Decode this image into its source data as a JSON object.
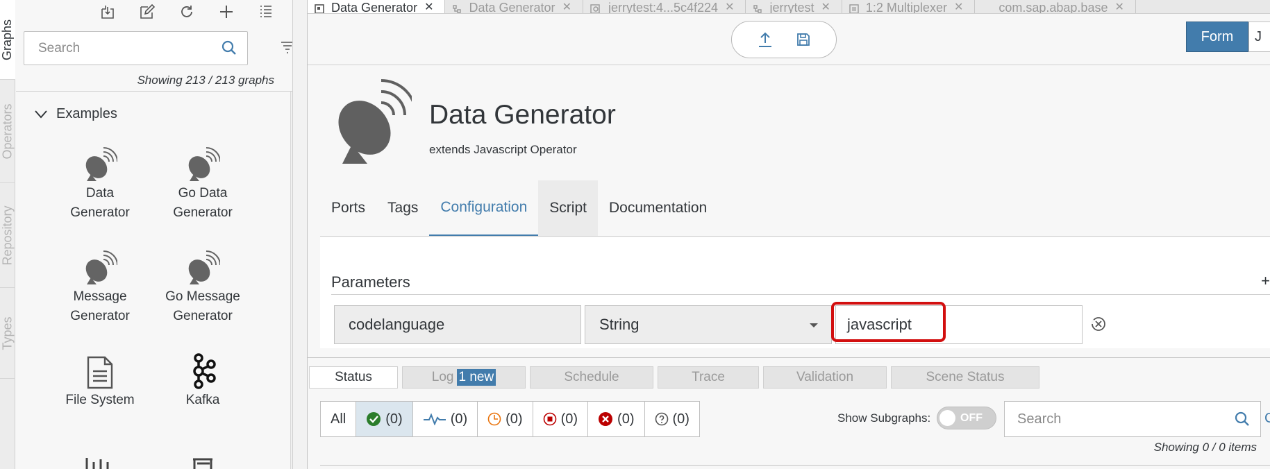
{
  "vertical_tabs": {
    "graphs": "Graphs",
    "operators": "Operators",
    "repository": "Repository",
    "types": "Types"
  },
  "left": {
    "search_placeholder": "Search",
    "showing": "Showing 213 / 213 graphs",
    "section": "Examples",
    "items": [
      {
        "label1": "Data",
        "label2": "Generator",
        "icon": "satellite-dish-icon"
      },
      {
        "label1": "Go Data",
        "label2": "Generator",
        "icon": "satellite-dish-icon"
      },
      {
        "label1": "Message",
        "label2": "Generator",
        "icon": "satellite-dish-icon"
      },
      {
        "label1": "Go Message",
        "label2": "Generator",
        "icon": "satellite-dish-icon"
      },
      {
        "label1": "File System",
        "label2": "",
        "icon": "document-icon"
      },
      {
        "label1": "Kafka",
        "label2": "",
        "icon": "kafka-icon"
      }
    ]
  },
  "editor_tabs": [
    {
      "label": "Data Generator",
      "active": true
    },
    {
      "label": "Data Generator",
      "active": false
    },
    {
      "label": "jerrytest:4...5c4f224",
      "active": false
    },
    {
      "label": "jerrytest",
      "active": false
    },
    {
      "label": "1:2 Multiplexer",
      "active": false
    },
    {
      "label": "com.sap.abap.base",
      "active": false
    }
  ],
  "view_toggle": {
    "form": "Form",
    "json": "J"
  },
  "operator": {
    "title": "Data Generator",
    "subtitle": "extends Javascript Operator"
  },
  "detail_tabs": {
    "ports": "Ports",
    "tags": "Tags",
    "configuration": "Configuration",
    "script": "Script",
    "documentation": "Documentation"
  },
  "parameters": {
    "heading": "Parameters",
    "plus": "+",
    "row": {
      "name": "codelanguage",
      "type": "String",
      "value": "javascript"
    }
  },
  "bottom_tabs": {
    "status": "Status",
    "log": "Log",
    "log_badge": "1 new",
    "schedule": "Schedule",
    "trace": "Trace",
    "validation": "Validation",
    "scene": "Scene Status"
  },
  "filters": {
    "all": "All",
    "ok": "(0)",
    "running": "(0)",
    "pending": "(0)",
    "stopped": "(0)",
    "error": "(0)",
    "unknown": "(0)"
  },
  "show_subgraphs": {
    "label": "Show Subgraphs:",
    "state": "OFF"
  },
  "bottom_search_placeholder": "Search",
  "bottom_showing": "Showing 0 / 0 items",
  "colors": {
    "accent": "#427cac",
    "highlight": "#d20f0f",
    "ok": "#2b7d2b",
    "error": "#bb0000",
    "pending": "#e9730c"
  }
}
